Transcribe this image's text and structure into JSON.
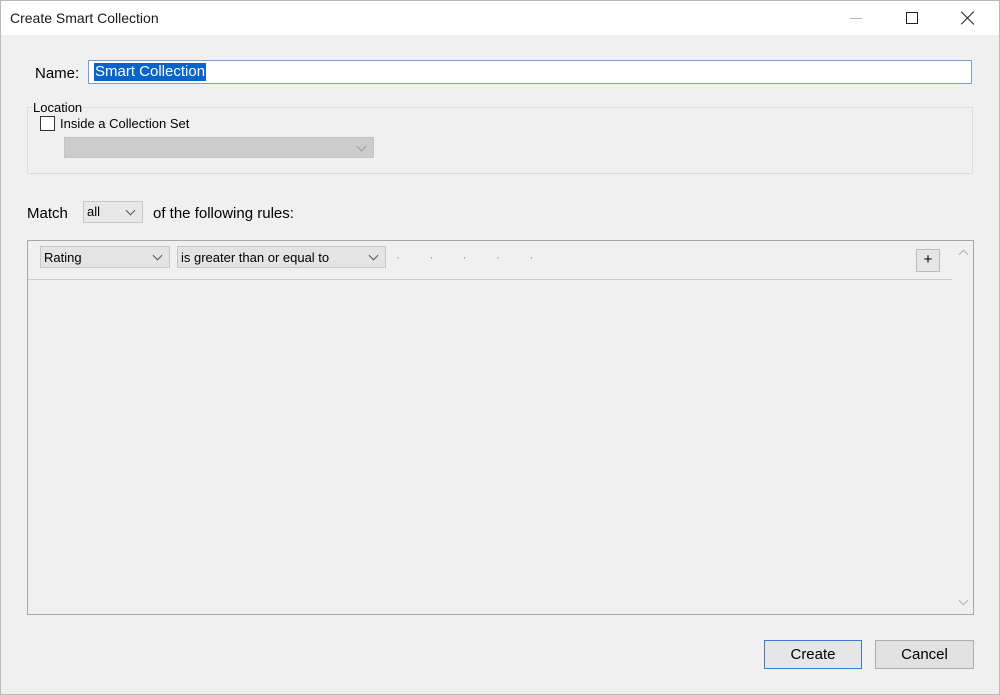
{
  "window": {
    "title": "Create Smart Collection"
  },
  "name": {
    "label": "Name:",
    "value": "Smart Collection"
  },
  "location": {
    "label": "Location",
    "checkbox_label": "Inside a Collection Set",
    "checked": false,
    "collection_set_value": ""
  },
  "match": {
    "prefix": "Match",
    "value": "all",
    "suffix": "of the following rules:"
  },
  "rules": [
    {
      "field": "Rating",
      "operator": "is greater than or equal to",
      "stars_value": "· · · · ·",
      "add_label": "+"
    }
  ],
  "buttons": {
    "create": "Create",
    "cancel": "Cancel"
  },
  "colors": {
    "selection": "#0a63c9",
    "default_button_border": "#3d7bd1"
  }
}
